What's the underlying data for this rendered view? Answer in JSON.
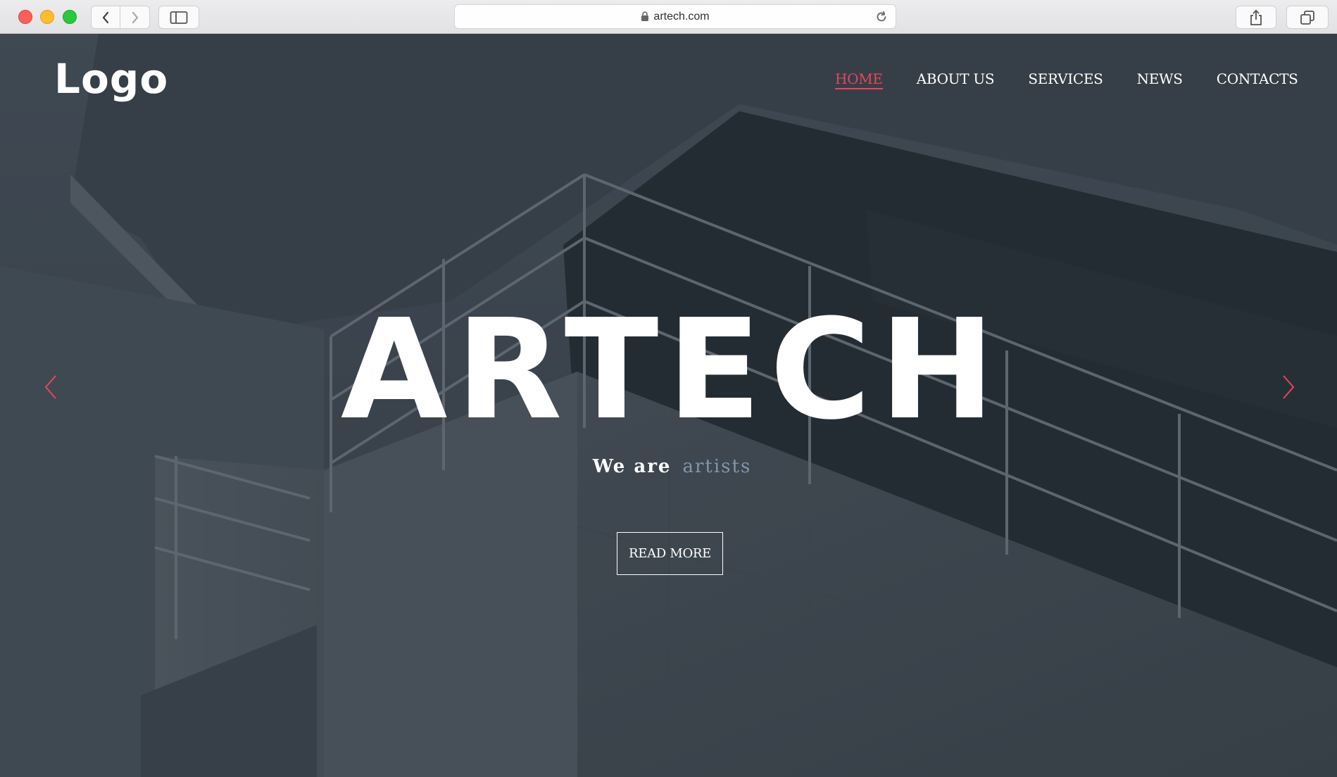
{
  "browser": {
    "url": "artech.com",
    "icons": {
      "back": "chevron-left-icon",
      "forward": "chevron-right-icon",
      "sidebar": "sidebar-icon",
      "lock": "lock-icon",
      "reload": "reload-icon",
      "share": "share-icon",
      "tabs": "tabs-icon"
    }
  },
  "site": {
    "logo": "Logo",
    "nav": [
      {
        "label": "HOME",
        "active": true
      },
      {
        "label": "ABOUT US",
        "active": false
      },
      {
        "label": "SERVICES",
        "active": false
      },
      {
        "label": "NEWS",
        "active": false
      },
      {
        "label": "CONTACTS",
        "active": false
      }
    ],
    "hero": {
      "title": "ARTECH",
      "tagline_lead": "We are",
      "tagline_accent": "artists",
      "cta_label": "READ MORE"
    }
  },
  "colors": {
    "accent": "#e8455d",
    "tagline_accent": "#7f97ad",
    "overlay": "#3e4750"
  }
}
